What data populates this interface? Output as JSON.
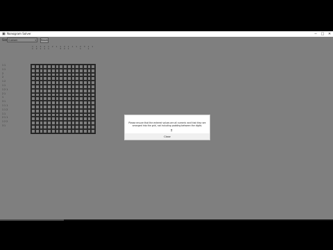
{
  "window": {
    "title": "Nonogram Solver",
    "controls": [
      "─",
      "□",
      "✕"
    ]
  },
  "toolbar": {
    "size_label": "Size:",
    "size_value": "Custom",
    "reset_label": "Reset"
  },
  "puzzle": {
    "column_clues": [
      "1\n1",
      "1\n2",
      "3\n1",
      "2\n1",
      "1\n1",
      "2",
      "1",
      "1\n3",
      "2\n2",
      "1\n1",
      "1",
      "1",
      "2\n1",
      "3",
      "1\n1",
      "1"
    ],
    "row_clues": [
      "1 1",
      "1 1",
      "2",
      "2",
      "1 2",
      "1 1",
      "1 2 1",
      "2 1",
      "1",
      "3 1",
      "1 1 1",
      "1 1 2",
      "1 1",
      "2 1 1",
      "1 2 2",
      "3 1"
    ],
    "rows": 17,
    "cols": 16
  },
  "dialog": {
    "message": "Please ensure that the entered values are all numeric and that they are arranged into the grid, not including padding between the digits.",
    "ok_label": "Close"
  }
}
